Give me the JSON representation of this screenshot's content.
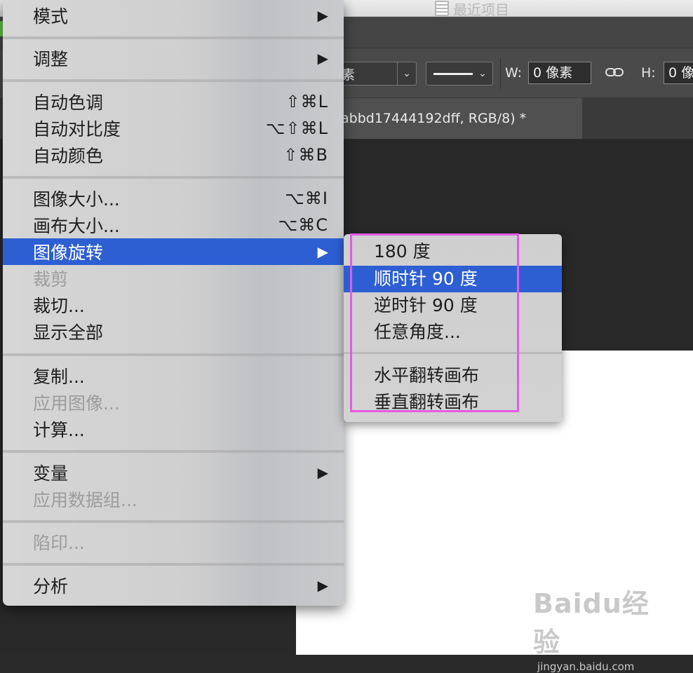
{
  "top_bar": {
    "recent_label": "最近项目"
  },
  "options_bar": {
    "unit_value": "素",
    "w_label": "W:",
    "w_value": "0 像素",
    "h_label": "H:",
    "h_value": "0 像"
  },
  "document_tab": {
    "title": "abbd17444192dff, RGB/8) *"
  },
  "menu": {
    "items": [
      {
        "label": "模式",
        "shortcut": "",
        "submenu": true
      },
      {
        "label": "调整",
        "shortcut": "",
        "submenu": true
      },
      {
        "label": "自动色调",
        "shortcut": "⇧⌘L"
      },
      {
        "label": "自动对比度",
        "shortcut": "⌥⇧⌘L"
      },
      {
        "label": "自动颜色",
        "shortcut": "⇧⌘B"
      },
      {
        "label": "图像大小...",
        "shortcut": "⌥⌘I"
      },
      {
        "label": "画布大小...",
        "shortcut": "⌥⌘C"
      },
      {
        "label": "图像旋转",
        "shortcut": "",
        "submenu": true,
        "selected": true
      },
      {
        "label": "裁剪",
        "shortcut": "",
        "disabled": true
      },
      {
        "label": "裁切...",
        "shortcut": ""
      },
      {
        "label": "显示全部",
        "shortcut": ""
      },
      {
        "label": "复制...",
        "shortcut": ""
      },
      {
        "label": "应用图像...",
        "shortcut": "",
        "disabled": true
      },
      {
        "label": "计算...",
        "shortcut": ""
      },
      {
        "label": "变量",
        "shortcut": "",
        "submenu": true
      },
      {
        "label": "应用数据组...",
        "shortcut": "",
        "disabled": true
      },
      {
        "label": "陷印...",
        "shortcut": "",
        "disabled": true
      },
      {
        "label": "分析",
        "shortcut": "",
        "submenu": true
      }
    ],
    "arrow_glyph": "▶"
  },
  "submenu": {
    "items": [
      {
        "label": "180 度"
      },
      {
        "label": "顺时针 90 度",
        "selected": true
      },
      {
        "label": "逆时针 90 度"
      },
      {
        "label": "任意角度..."
      },
      {
        "label": "水平翻转画布"
      },
      {
        "label": "垂直翻转画布"
      }
    ]
  },
  "watermark": {
    "logo": "Baidu经验",
    "sub": "jingyan.baidu.com"
  },
  "colors": {
    "selection": "#2d5fd3",
    "highlight_box": "#e25ce4"
  }
}
